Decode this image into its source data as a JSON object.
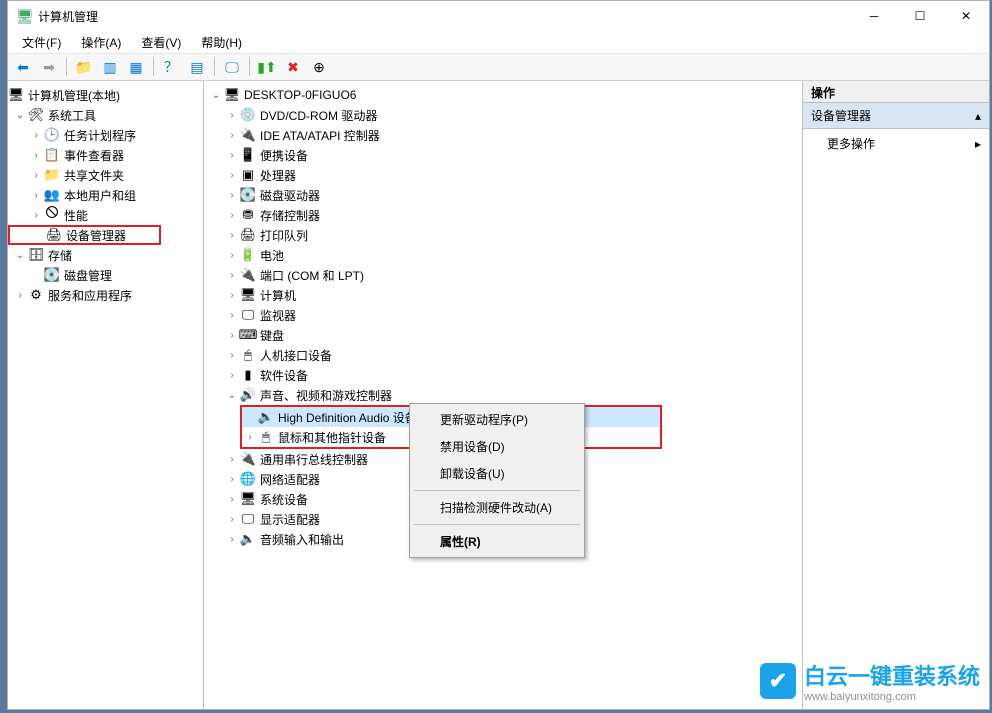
{
  "window": {
    "title": "计算机管理"
  },
  "menu": {
    "file": "文件(F)",
    "action": "操作(A)",
    "view": "查看(V)",
    "help": "帮助(H)"
  },
  "left_tree": {
    "root": "计算机管理(本地)",
    "system_tools": "系统工具",
    "task_scheduler": "任务计划程序",
    "event_viewer": "事件查看器",
    "shared_folders": "共享文件夹",
    "local_users": "本地用户和组",
    "performance": "性能",
    "device_manager": "设备管理器",
    "storage": "存储",
    "disk_mgmt": "磁盘管理",
    "services_apps": "服务和应用程序"
  },
  "mid_tree": {
    "root": "DESKTOP-0FIGUO6",
    "dvd": "DVD/CD-ROM 驱动器",
    "ide": "IDE ATA/ATAPI 控制器",
    "portable": "便携设备",
    "cpu": "处理器",
    "disk_drive": "磁盘驱动器",
    "storage_ctrl": "存储控制器",
    "print_queue": "打印队列",
    "battery": "电池",
    "ports": "端口 (COM 和 LPT)",
    "computer": "计算机",
    "monitor": "监视器",
    "keyboard": "键盘",
    "hid": "人机接口设备",
    "software_dev": "软件设备",
    "sound": "声音、视频和游戏控制器",
    "hd_audio": "High Definition Audio 设备",
    "mouse": "鼠标和其他指针设备",
    "usb": "通用串行总线控制器",
    "network": "网络适配器",
    "system_dev": "系统设备",
    "display": "显示适配器",
    "audio_io": "音频输入和输出"
  },
  "context": {
    "update_driver": "更新驱动程序(P)",
    "disable": "禁用设备(D)",
    "uninstall": "卸载设备(U)",
    "scan": "扫描检测硬件改动(A)",
    "properties": "属性(R)"
  },
  "right": {
    "header": "操作",
    "section": "设备管理器",
    "more": "更多操作"
  },
  "watermark": {
    "title": "白云一键重装系统",
    "url": "www.baiyunxitong.com"
  }
}
